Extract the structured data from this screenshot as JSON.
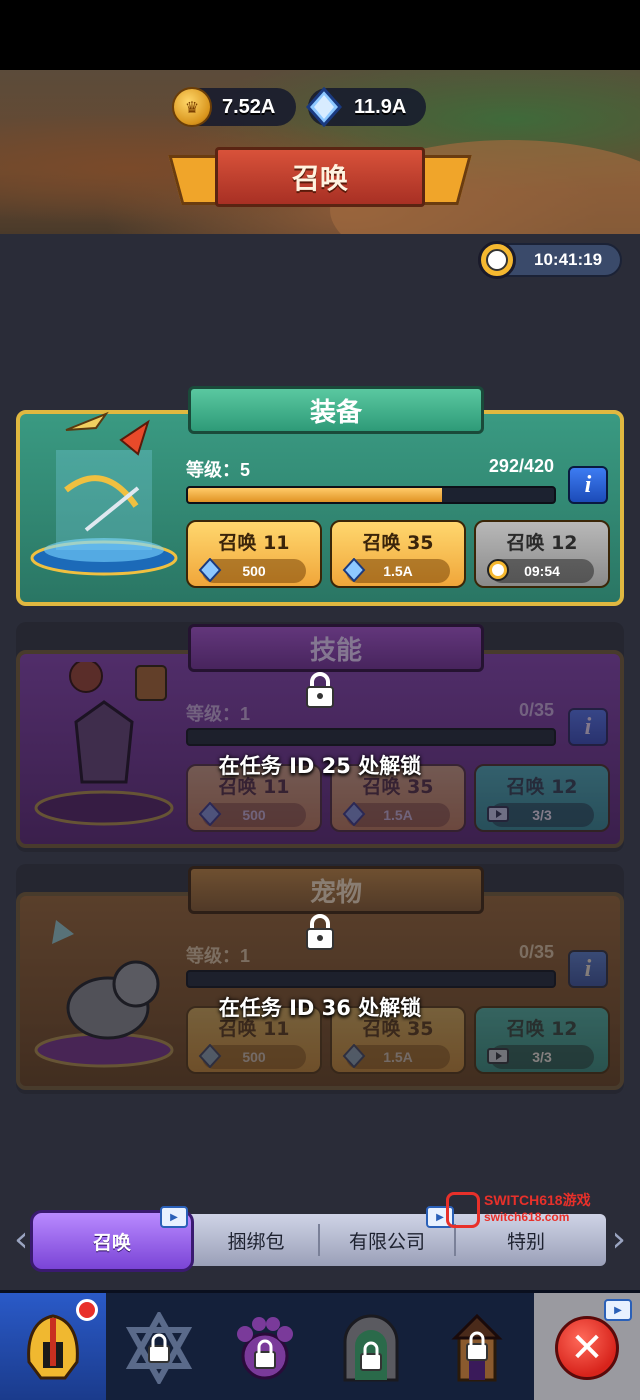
{
  "header": {
    "gold_amount": "7.52A",
    "gem_amount": "11.9A",
    "title": "召唤",
    "timer": "10:41:19"
  },
  "cards": [
    {
      "title": "装备",
      "level_label": "等级：",
      "level": "5",
      "progress_text": "292/420",
      "progress": 0.695,
      "buttons": [
        {
          "label": "召唤 11",
          "cost": "500",
          "cost_icon": "gem-icon"
        },
        {
          "label": "召唤 35",
          "cost": "1.5A",
          "cost_icon": "gem-icon"
        },
        {
          "label": "召唤 12",
          "cost": "09:54",
          "cost_icon": "clock-icon"
        }
      ]
    },
    {
      "title": "技能",
      "level_label": "等级：",
      "level": "1",
      "progress_text": "0/35",
      "progress": 0,
      "unlock_text": "在任务 ID 25 处解锁",
      "buttons": [
        {
          "label": "召唤 11",
          "cost": "500",
          "cost_icon": "gem-icon"
        },
        {
          "label": "召唤 35",
          "cost": "1.5A",
          "cost_icon": "gem-icon"
        },
        {
          "label": "召唤 12",
          "cost": "3/3",
          "cost_icon": "video-icon"
        }
      ]
    },
    {
      "title": "宠物",
      "level_label": "等级：",
      "level": "1",
      "progress_text": "0/35",
      "progress": 0,
      "unlock_text": "在任务 ID 36 处解锁",
      "buttons": [
        {
          "label": "召唤 11",
          "cost": "500",
          "cost_icon": "gem-icon"
        },
        {
          "label": "召唤 35",
          "cost": "1.5A",
          "cost_icon": "gem-icon"
        },
        {
          "label": "召唤 12",
          "cost": "3/3",
          "cost_icon": "video-icon"
        }
      ]
    }
  ],
  "info_label": "i",
  "tabs": [
    "召唤",
    "捆绑包",
    "有限公司",
    "特别"
  ],
  "bottom_nav": [
    "helmet-icon",
    "star-lock-icon",
    "paw-lock-icon",
    "gate-lock-icon",
    "tower-lock-icon",
    "close-icon"
  ],
  "close_symbol": "✕",
  "watermark": {
    "line1": "SWITCH618游戏",
    "line2": "switch618.com"
  },
  "colors": {
    "equipment": "#2f8a72",
    "skill": "#6a2a8a",
    "pet": "#7a5028",
    "accent_gold": "#f0a63a"
  }
}
